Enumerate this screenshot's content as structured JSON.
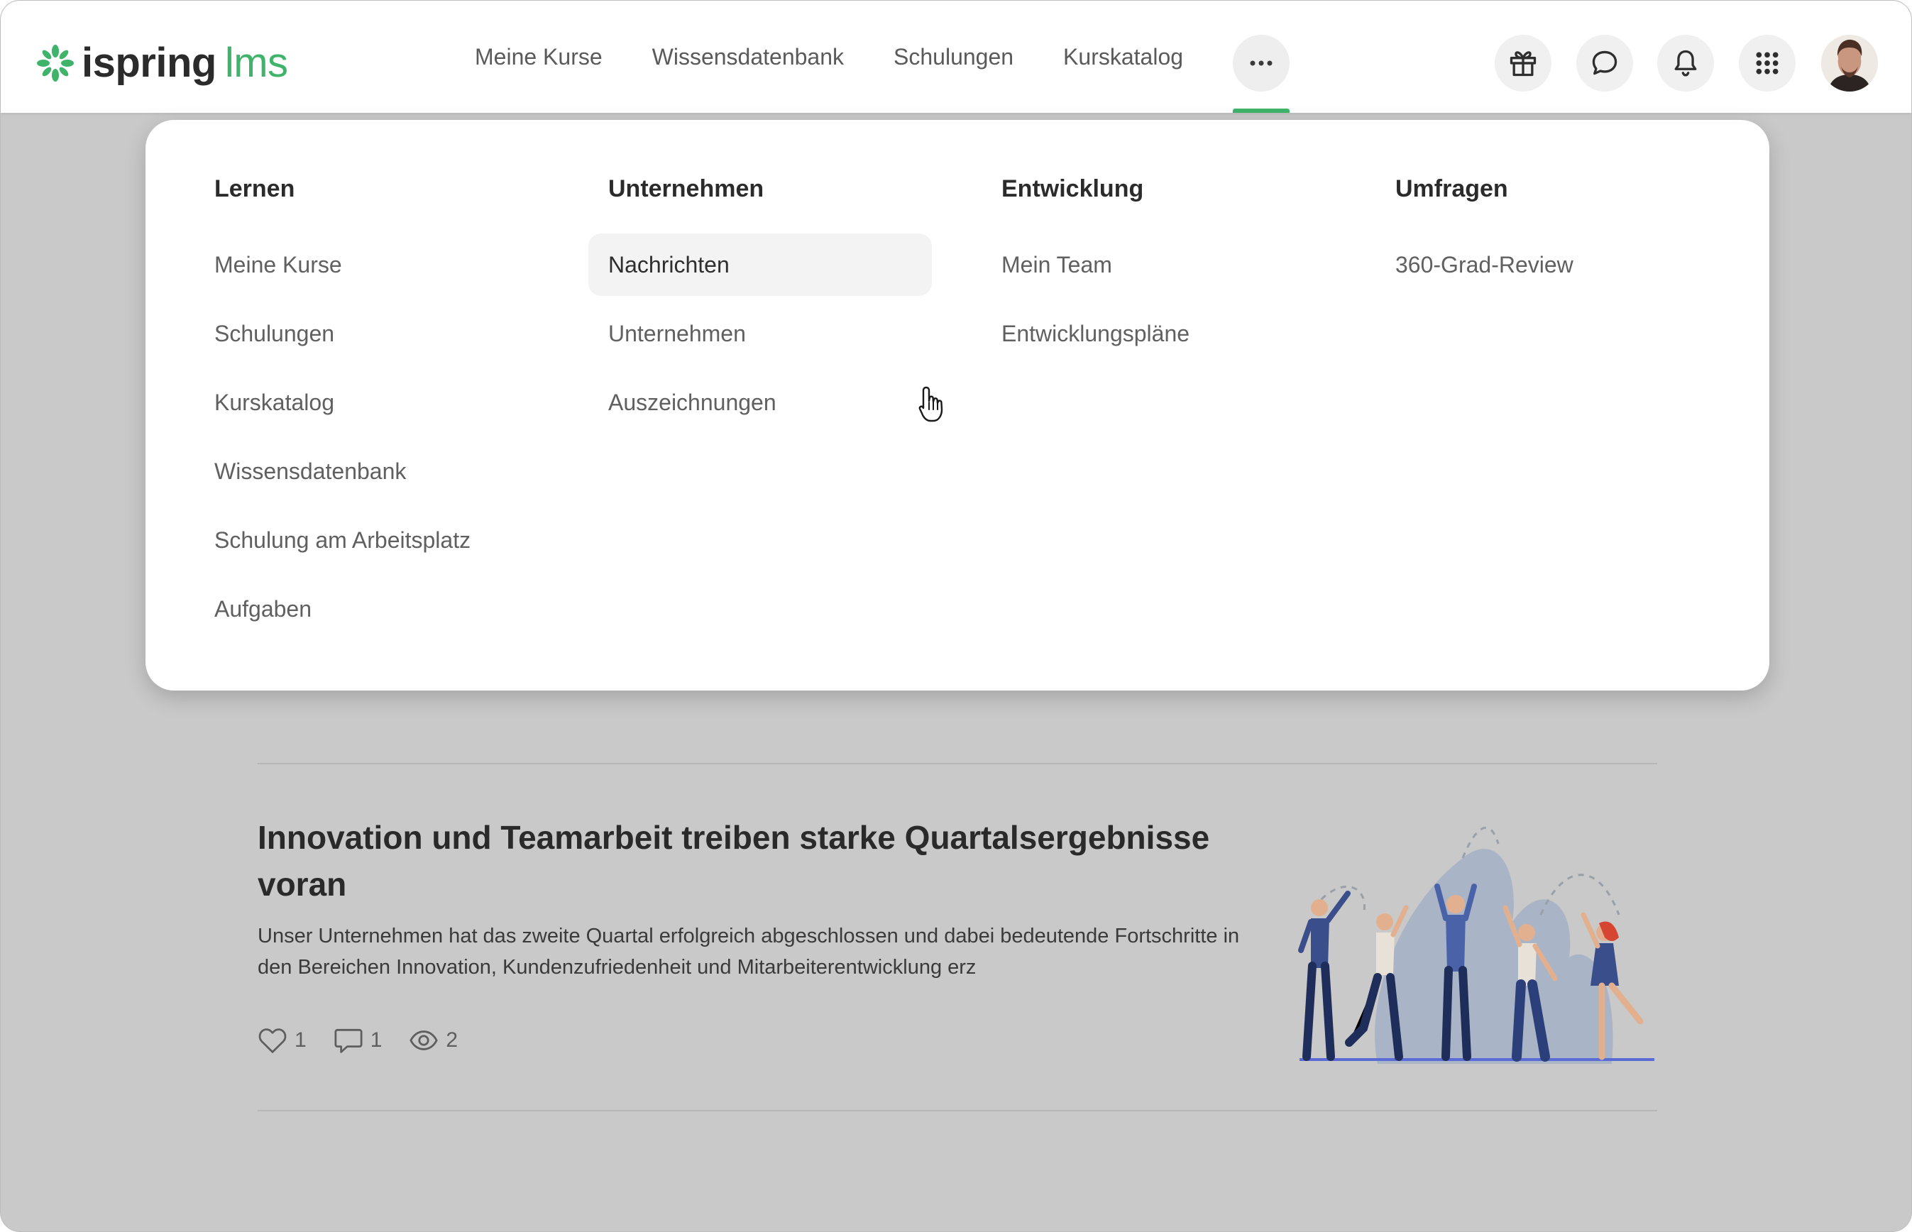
{
  "header": {
    "logo": {
      "brand": "ispring",
      "product": "lms"
    },
    "nav": [
      "Meine Kurse",
      "Wissensdatenbank",
      "Schulungen",
      "Kurskatalog"
    ],
    "more_label": "···",
    "icons": [
      "gift-icon",
      "chat-icon",
      "bell-icon",
      "apps-grid-icon"
    ]
  },
  "menu": {
    "columns": [
      {
        "heading": "Lernen",
        "items": [
          "Meine Kurse",
          "Schulungen",
          "Kurskatalog",
          "Wissensdatenbank",
          "Schulung am Arbeitsplatz",
          "Aufgaben"
        ]
      },
      {
        "heading": "Unternehmen",
        "items": [
          "Nachrichten",
          "Unternehmen",
          "Auszeichnungen"
        ]
      },
      {
        "heading": "Entwicklung",
        "items": [
          "Mein Team",
          "Entwicklungspläne"
        ]
      },
      {
        "heading": "Umfragen",
        "items": [
          "360-Grad-Review"
        ]
      }
    ],
    "hovered_item": "Nachrichten"
  },
  "article": {
    "title": "Innovation und Teamarbeit treiben starke Quartalsergebnisse voran",
    "excerpt": "Unser Unternehmen hat das zweite Quartal erfolgreich abgeschlossen und dabei bedeutende Fortschritte in den Bereichen Innovation, Kundenzufriedenheit und Mitarbeiterentwicklung erz",
    "likes": "1",
    "comments": "1",
    "views": "2"
  },
  "colors": {
    "accent": "#3fb36a",
    "overlay_background": "#c9c9c9",
    "menu_background": "#ffffff"
  }
}
